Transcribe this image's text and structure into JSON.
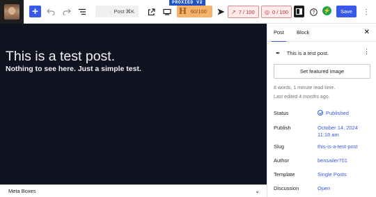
{
  "toolbar": {
    "icons": [
      "site-avatar",
      "plus-icon",
      "undo-icon",
      "redo-icon",
      "list-view-icon",
      "external-link-icon",
      "desktop-preview-icon",
      "send-icon",
      "settings-panel-icon",
      "help-icon",
      "bolt-icon",
      "more-vertical-icon"
    ],
    "doc_title": "Post ⌘K",
    "proxied_label": "PROXIED V2",
    "h_score": "60/100",
    "score_a": "7 / 100",
    "score_b": "0 / 100",
    "save_label": "Save",
    "colors": {
      "accent": "#3858e9",
      "h_badge": "#f6b26b",
      "score_pill": "#fdeaea",
      "canvas": "#121320"
    }
  },
  "canvas": {
    "title": "This is a test post.",
    "content": "Nothing to see here. Just a simple test."
  },
  "metabox": {
    "label": "Meta Boxes"
  },
  "sidebar": {
    "tabs": [
      {
        "label": "Post"
      },
      {
        "label": "Block"
      }
    ],
    "active_tab": "Post",
    "post_title": "This is a test post.",
    "featured_image_label": "Set featured image",
    "word_count": "8 words, 1 minute read time.",
    "last_edited": "Last edited 4 months ago.",
    "fields": {
      "status": {
        "label": "Status",
        "value": "Published"
      },
      "publish": {
        "label": "Publish",
        "value_line1": "October 14, 2024",
        "value_line2": "11:18 am"
      },
      "slug": {
        "label": "Slug",
        "value": "this-is-a-test-post"
      },
      "author": {
        "label": "Author",
        "value": "bensailer701"
      },
      "template": {
        "label": "Template",
        "value": "Single Posts"
      },
      "discussion": {
        "label": "Discussion",
        "value": "Open"
      }
    }
  }
}
